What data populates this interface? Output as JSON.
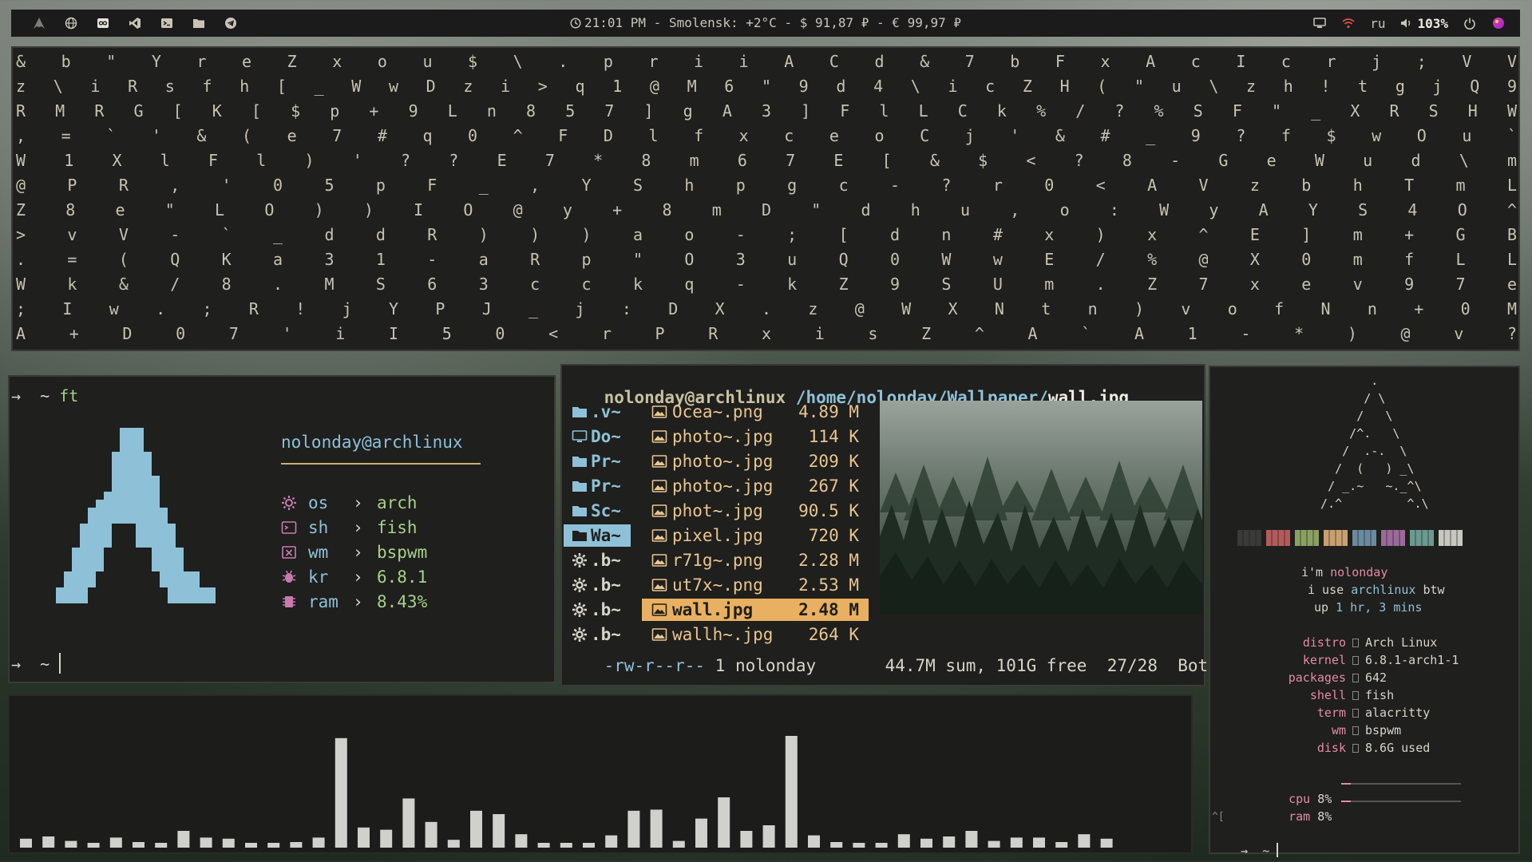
{
  "topbar": {
    "icons_left": [
      "arch-icon",
      "globe-icon",
      "infinity-icon",
      "vscode-icon",
      "terminal-icon",
      "folder-icon",
      "telegram-icon"
    ],
    "status": "21:01 PM - Smolensk: +2°C - $ 91,87 ₽ - € 99,97 ₽",
    "lang": "ru",
    "volume": "103%",
    "icons_right": [
      "monitor-icon",
      "wifi-icon",
      "volume-icon",
      "power-icon",
      "color-icon"
    ]
  },
  "matrix": {
    "rows": [
      "& b \"   Y   r e Z x   o u $     \\       .   p r     i i                   A         C d & 7       b         F x A   c I     c r j ; V         V",
      "z \\ i R s f h   [ _   W w D     z       i > q 1 @       M           6 \"       9 d         4 \\ i c Z               H ( \" u     \\ z     h ! t g j         Q   9",
      "  R M R G [ K   [   $     p       +     9 L n 8 5 7     ]     g A     3 ]       F l         L C k % /               ? %         S F     \" _ X R S         H   W",
      "  , = ` ' & (   e   7                   # q 0   ^ F     D     l f     x c       e o C       j ' &   #               _           9 ?     f $ w O           u   `",
      "  W 1 X l F l   )   '                   ? ? E     7     *     8 m     6 7       E [ &       $ <     ?         8 -       G   e     W   u d         \\   m",
      "      @ P R ,   '   0                   5 p F     _ , Y     S h     p         g c -         ?     r         0 <       A   V     z   b h     T       m L",
      "      Z 8 e     \"   L                   O ) ) I     O @     y +     8         m D \" d       h   u ,   o   : W     y   A   Y           S 4     O ^",
      "    > v   V   -     `                   _ d   d     R )       ) )     a       o - ; [       d   n #   x ) x ^     E   ]               m + G   B",
      "  . = (   Q   K             a       3       1     -       a R       p \" O 3 u Q 0       W     w E /     % @             X   0 m f   L   L",
      "  W k &       /             8             . M     S   6     3       c c k q - k Z       9   S U m .     Z 7             x e v   9   7   e",
      "  ; I w       .   ;         R   !       j Y     P J _     j       : D   X . z @       W   X N t n     ) v o           f N n   +   0   M",
      "A + D 0     7     '         i   I       5       0 <       r       P R   x i   s       Z   ^ A   `     A 1 -           * ) @   v       ?"
    ]
  },
  "fetch": {
    "cmd_prefix": "→  ~ ",
    "cmd": "ft",
    "user_host": "nolonday@archlinux",
    "rows": [
      {
        "icon": "gear-icon",
        "key": "os",
        "sep": "›",
        "val": "arch"
      },
      {
        "icon": "terminal-icon",
        "key": "sh",
        "sep": "›",
        "val": "fish"
      },
      {
        "icon": "window-icon",
        "key": "wm",
        "sep": "›",
        "val": "bspwm"
      },
      {
        "icon": "bug-icon",
        "key": "kr",
        "sep": "›",
        "val": "6.8.1"
      },
      {
        "icon": "chip-icon",
        "key": "ram",
        "sep": "›",
        "val": "8.43%"
      }
    ],
    "prompt2": "→  ~ "
  },
  "fm": {
    "header_user": "nolonday@archlinux",
    "header_path": "/home/nolonday/Wallpaper/",
    "header_file": "wall.jpg",
    "left": [
      {
        "icon": "folder-icon",
        "name": ".v~"
      },
      {
        "icon": "desktop-icon",
        "name": "Do~"
      },
      {
        "icon": "folder-icon",
        "name": "Pr~"
      },
      {
        "icon": "folder-icon",
        "name": "Pr~"
      },
      {
        "icon": "folder-icon",
        "name": "Sc~"
      },
      {
        "icon": "folder-icon",
        "name": "Wa~",
        "selected": true
      },
      {
        "icon": "gear-icon",
        "name": ".b~"
      },
      {
        "icon": "gear-icon",
        "name": ".b~"
      },
      {
        "icon": "gear-icon",
        "name": ".b~"
      },
      {
        "icon": "gear-icon",
        "name": ".b~"
      }
    ],
    "files": [
      {
        "name": "Ocea~.png",
        "size": "4.89 M"
      },
      {
        "name": "photo~.jpg",
        "size": "114 K"
      },
      {
        "name": "photo~.jpg",
        "size": "209 K"
      },
      {
        "name": "photo~.jpg",
        "size": "267 K"
      },
      {
        "name": "phot~.jpg",
        "size": "90.5 K"
      },
      {
        "name": "pixel.jpg",
        "size": " 720 K"
      },
      {
        "name": "r71g~.png",
        "size": "2.28 M"
      },
      {
        "name": "ut7x~.png",
        "size": "2.53 M"
      },
      {
        "name": "wall.jpg",
        "size": " 2.48 M",
        "selected": true
      },
      {
        "name": "wallh~.jpg",
        "size": "264 K"
      }
    ],
    "footer_perm": "-rw-r--r--",
    "footer_owner": "1 nolonday",
    "footer_info": "44.7M sum, 101G free",
    "footer_pos": "27/28",
    "footer_scroll": "Bot"
  },
  "neofetch": {
    "logo": [
      "         .",
      "        / \\",
      "       /   \\",
      "      /^.   \\",
      "     /  .-.  \\",
      "    /  (   ) _\\",
      "   / _.~   ~._^\\",
      "  /.^         ^.\\"
    ],
    "palette": [
      "#3a3a38",
      "#b45a5a",
      "#8aa060",
      "#c8a070",
      "#6a8aa0",
      "#9a6a9a",
      "#6a9a90",
      "#c8c8c0"
    ],
    "im": "i'm ",
    "user": "nolonday",
    "use": "i use ",
    "distro_word": "archlinux",
    "btw": " btw",
    "up": "up ",
    "uptime": "1 hr, 3 mins",
    "info": [
      {
        "key": "distro",
        "val": "Arch Linux"
      },
      {
        "key": "kernel",
        "val": "6.8.1-arch1-1"
      },
      {
        "key": "packages",
        "val": "642"
      },
      {
        "key": "shell",
        "val": "fish"
      },
      {
        "key": "term",
        "val": "alacritty"
      },
      {
        "key": "wm",
        "val": "bspwm"
      },
      {
        "key": "disk",
        "val": "8.6G used"
      }
    ],
    "cpu_label": "cpu",
    "cpu_val": "8%",
    "cpu_fraction": 0.08,
    "ram_label": "ram",
    "ram_val": "8%",
    "ram_fraction": 0.08,
    "ctrl_line": "^[",
    "prompt": "→  ~ "
  },
  "cava": {
    "levels": [
      0.08,
      0.1,
      0.06,
      0.03,
      0.09,
      0.05,
      0.04,
      0.15,
      0.09,
      0.08,
      0.03,
      0.03,
      0.05,
      0.09,
      0.98,
      0.18,
      0.16,
      0.44,
      0.23,
      0.07,
      0.33,
      0.3,
      0.12,
      0.03,
      0.02,
      0.03,
      0.11,
      0.33,
      0.34,
      0.06,
      0.26,
      0.45,
      0.15,
      0.2,
      1.0,
      0.11,
      0.05,
      0.03,
      0.02,
      0.12,
      0.08,
      0.1,
      0.15,
      0.06,
      0.09,
      0.09,
      0.05,
      0.12,
      0.08
    ],
    "bar_color": "#d0d0cc"
  }
}
